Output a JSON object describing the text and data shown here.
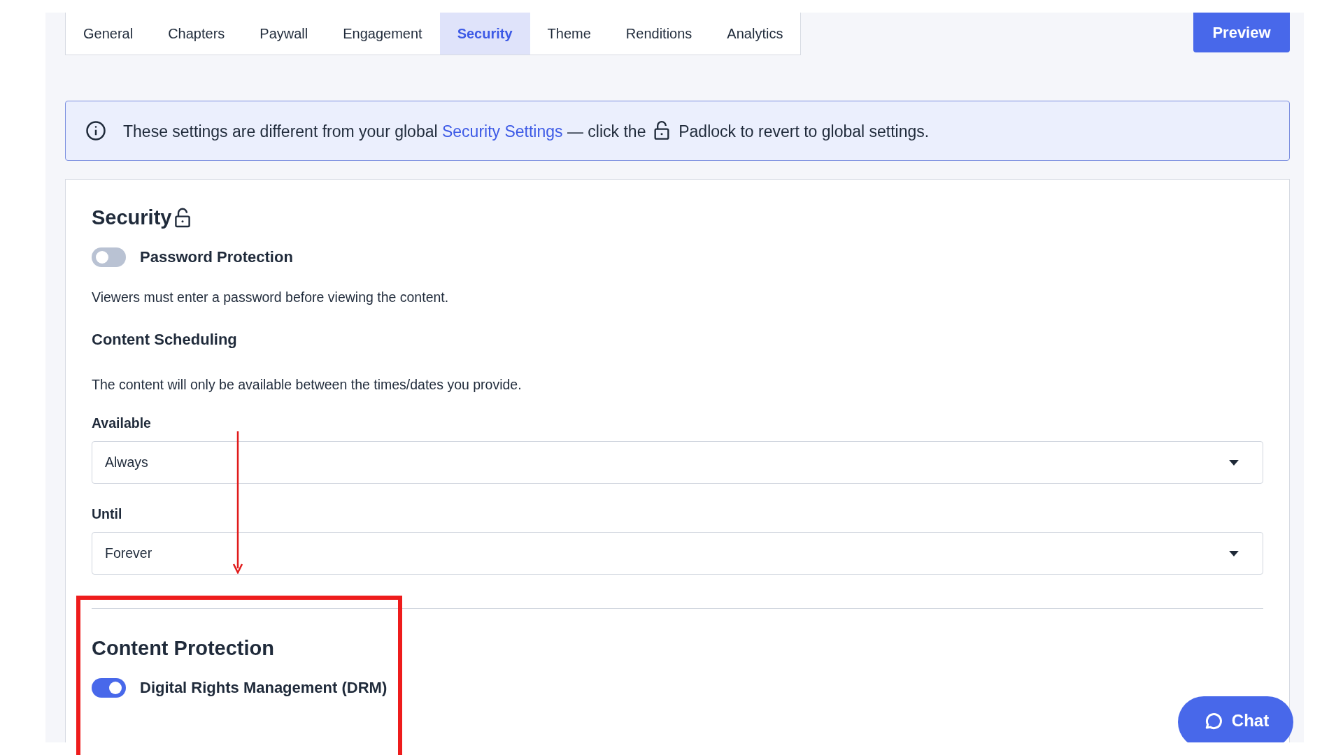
{
  "tabs": [
    {
      "label": "General",
      "selected": false
    },
    {
      "label": "Chapters",
      "selected": false
    },
    {
      "label": "Paywall",
      "selected": false
    },
    {
      "label": "Engagement",
      "selected": false
    },
    {
      "label": "Security",
      "selected": true
    },
    {
      "label": "Theme",
      "selected": false
    },
    {
      "label": "Renditions",
      "selected": false
    },
    {
      "label": "Analytics",
      "selected": false
    }
  ],
  "preview_button": "Preview",
  "banner": {
    "text_before": "These settings are different from your global ",
    "link": "Security Settings",
    "text_middle": " — click the ",
    "text_after": " Padlock to revert to global settings."
  },
  "security": {
    "title": "Security",
    "password_protection": {
      "label": "Password Protection",
      "on": false
    },
    "description": "Viewers must enter a password before viewing the content.",
    "scheduling": {
      "title": "Content Scheduling",
      "description": "The content will only be available between the times/dates you provide.",
      "fields": [
        {
          "label": "Available",
          "value": "Always"
        },
        {
          "label": "Until",
          "value": "Forever"
        }
      ]
    }
  },
  "content_protection": {
    "title": "Content Protection",
    "drm": {
      "label": "Digital Rights Management (DRM)",
      "on": true
    }
  },
  "chat_button": "Chat"
}
